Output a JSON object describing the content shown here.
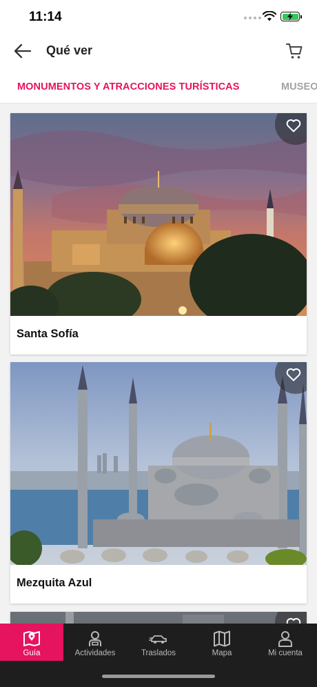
{
  "status_bar": {
    "time": "11:14",
    "battery_color": "#34c759"
  },
  "header": {
    "title": "Qué ver",
    "back_icon": "arrow-left-icon",
    "cart_icon": "cart-icon"
  },
  "tabs": [
    {
      "label": "MONUMENTOS Y ATRACCIONES TURÍSTICAS",
      "active": true
    },
    {
      "label": "MUSEOS",
      "active": false
    }
  ],
  "cards": [
    {
      "title": "Santa Sofía",
      "image": "hagia-sophia-photo",
      "favorite_icon": "heart-outline-icon"
    },
    {
      "title": "Mezquita Azul",
      "image": "blue-mosque-photo",
      "favorite_icon": "heart-outline-icon"
    },
    {
      "title": "",
      "image": "mosque-photo",
      "favorite_icon": "heart-outline-icon"
    }
  ],
  "bottom_nav": [
    {
      "label": "Guía",
      "icon": "map-book-icon",
      "active": true
    },
    {
      "label": "Actividades",
      "icon": "guide-person-icon",
      "active": false
    },
    {
      "label": "Traslados",
      "icon": "transfer-car-icon",
      "active": false
    },
    {
      "label": "Mapa",
      "icon": "map-icon",
      "active": false
    },
    {
      "label": "Mi cuenta",
      "icon": "user-icon",
      "active": false
    }
  ],
  "colors": {
    "accent": "#e6135f",
    "nav_background": "#1e1e1e",
    "tab_inactive": "#a2a2a2"
  }
}
